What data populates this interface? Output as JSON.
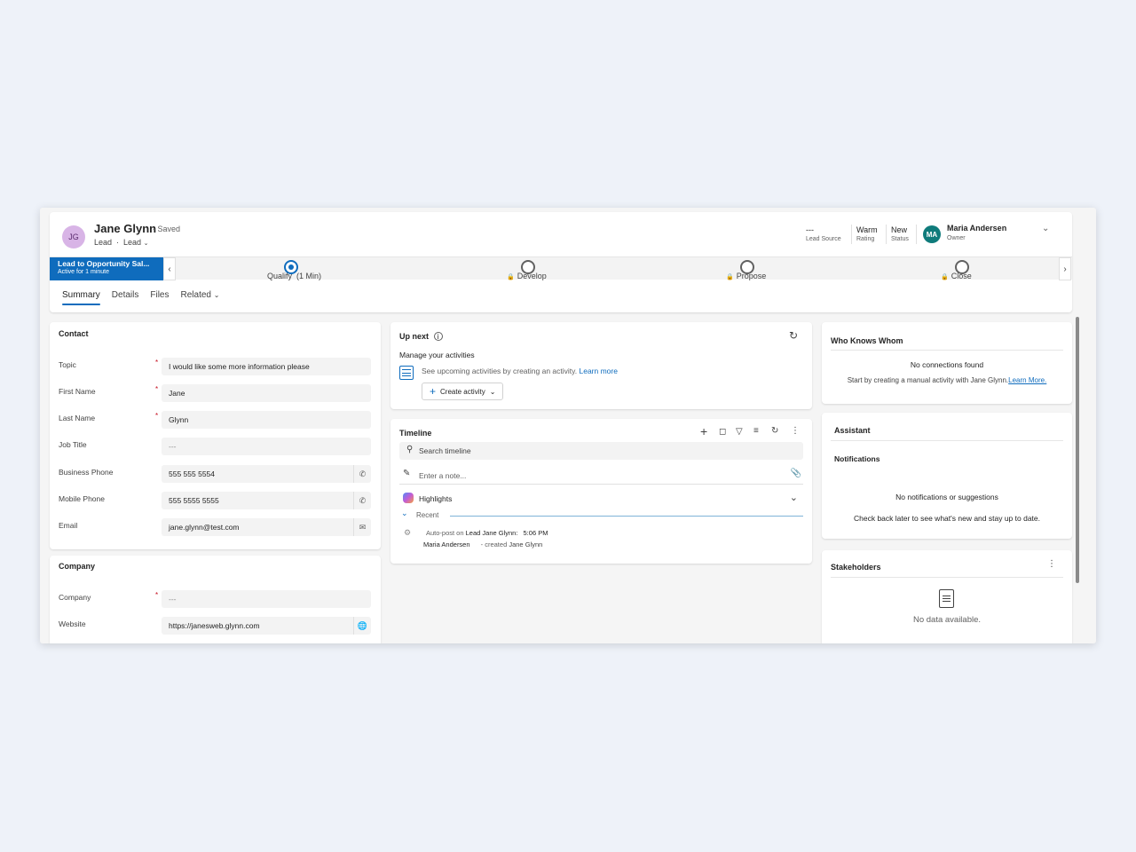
{
  "record": {
    "initials": "JG",
    "name": "Jane Glynn",
    "saved": "- Saved",
    "entity": "Lead",
    "dot": "·",
    "form": "Lead"
  },
  "header_fields": [
    {
      "value": "---",
      "label": "Lead Source"
    },
    {
      "value": "Warm",
      "label": "Rating"
    },
    {
      "value": "New",
      "label": "Status"
    }
  ],
  "owner": {
    "initials": "MA",
    "name": "Maria Andersen",
    "label": "Owner"
  },
  "bpf": {
    "process": "Lead to Opportunity Sal...",
    "active_for": "Active for 1 minute",
    "stages": [
      {
        "label": "Qualify",
        "duration": "(1 Min)",
        "active": true
      },
      {
        "label": "Develop",
        "locked": true
      },
      {
        "label": "Propose",
        "locked": true
      },
      {
        "label": "Close",
        "locked": true
      }
    ]
  },
  "tabs": [
    "Summary",
    "Details",
    "Files",
    "Related"
  ],
  "contact": {
    "title": "Contact",
    "fields": [
      {
        "label": "Topic",
        "value": "I would like some more information please",
        "required": true
      },
      {
        "label": "First Name",
        "value": "Jane",
        "required": true
      },
      {
        "label": "Last Name",
        "value": "Glynn",
        "required": true
      },
      {
        "label": "Job Title",
        "value": "---"
      },
      {
        "label": "Business Phone",
        "value": "555 555 5554",
        "icon": "phone-icon"
      },
      {
        "label": "Mobile Phone",
        "value": "555 5555 5555",
        "icon": "phone-icon"
      },
      {
        "label": "Email",
        "value": "jane.glynn@test.com",
        "icon": "mail-icon"
      }
    ]
  },
  "company": {
    "title": "Company",
    "fields": [
      {
        "label": "Company",
        "value": "---",
        "required": true
      },
      {
        "label": "Website",
        "value": "https://janesweb.glynn.com",
        "icon": "globe-icon"
      }
    ]
  },
  "up_next": {
    "title": "Up next",
    "heading": "Manage your activities",
    "text": "See upcoming activities by creating an activity.",
    "link": "Learn more",
    "button": "Create activity"
  },
  "timeline": {
    "title": "Timeline",
    "search_placeholder": "Search timeline",
    "note_placeholder": "Enter a note...",
    "highlights": "Highlights",
    "recent": "Recent",
    "post": {
      "prefix": "Auto-post on",
      "subject": "Lead Jane Glynn:",
      "time": "5:06 PM",
      "author": "Maria Andersen",
      "action": "created",
      "target": "Jane Glynn"
    }
  },
  "who_knows": {
    "title": "Who Knows Whom",
    "empty": "No connections found",
    "text": "Start by creating a manual activity with Jane Glynn.",
    "link": "Learn More."
  },
  "assistant": {
    "title": "Assistant",
    "subtitle": "Notifications",
    "empty": "No notifications or suggestions",
    "text": "Check back later to see what's new and stay up to date."
  },
  "stakeholders": {
    "title": "Stakeholders",
    "empty": "No data available."
  }
}
